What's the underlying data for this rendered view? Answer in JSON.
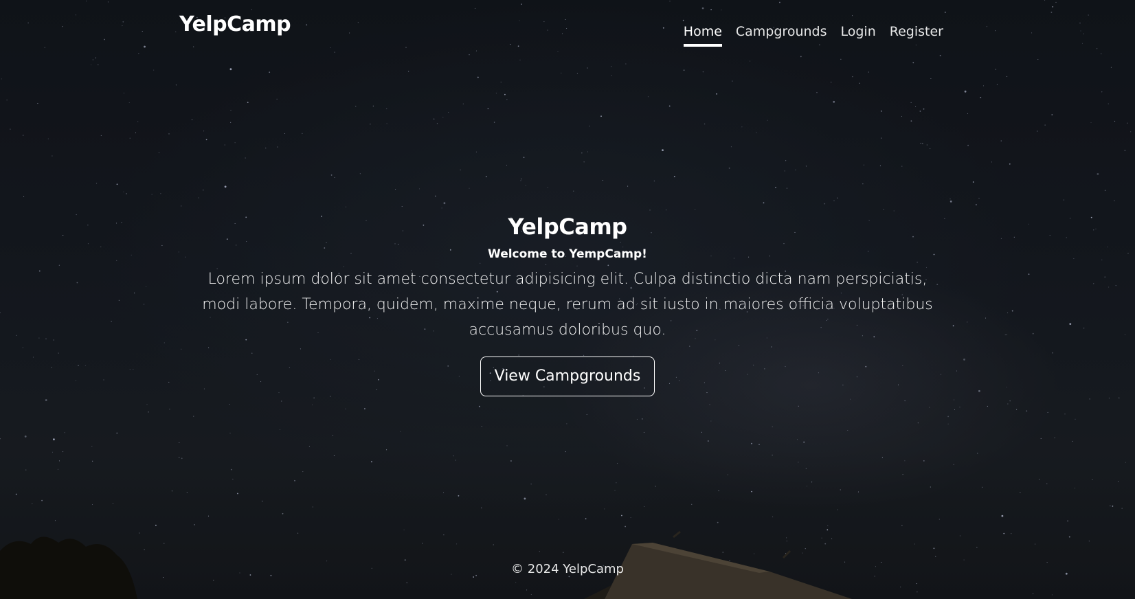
{
  "navbar": {
    "brand": "YelpCamp",
    "links": [
      {
        "label": "Home",
        "active": true
      },
      {
        "label": "Campgrounds",
        "active": false
      },
      {
        "label": "Login",
        "active": false
      },
      {
        "label": "Register",
        "active": false
      }
    ]
  },
  "hero": {
    "title": "YelpCamp",
    "subtitle": "Welcome to YempCamp!",
    "lead": "Lorem ipsum dolor sit amet consectetur adipisicing elit. Culpa distinctio dicta nam perspiciatis, modi labore. Tempora, quidem, maxime neque, rerum ad sit iusto in maiores officia voluptatibus accusamus doloribus quo.",
    "button_label": "View Campgrounds"
  },
  "footer": {
    "copyright": "© 2024 YelpCamp"
  },
  "colors": {
    "text": "#ffffff",
    "background": "#161b22"
  }
}
